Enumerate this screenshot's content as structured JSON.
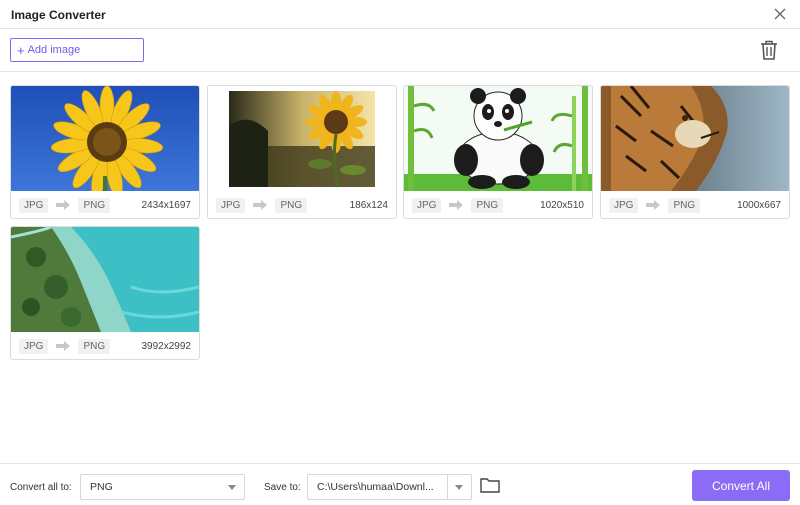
{
  "window": {
    "title": "Image Converter"
  },
  "toolbar": {
    "add_image_label": "Add image"
  },
  "images": [
    {
      "source_format": "JPG",
      "target_format": "PNG",
      "dimensions": "2434x1697"
    },
    {
      "source_format": "JPG",
      "target_format": "PNG",
      "dimensions": "186x124"
    },
    {
      "source_format": "JPG",
      "target_format": "PNG",
      "dimensions": "1020x510"
    },
    {
      "source_format": "JPG",
      "target_format": "PNG",
      "dimensions": "1000x667"
    },
    {
      "source_format": "JPG",
      "target_format": "PNG",
      "dimensions": "3992x2992"
    }
  ],
  "bottom": {
    "convert_all_label": "Convert all to:",
    "convert_all_value": "PNG",
    "save_to_label": "Save to:",
    "save_to_value": "C:\\Users\\humaa\\Downl...",
    "convert_button": "Convert All"
  },
  "colors": {
    "accent": "#8b6cf7",
    "accent_border": "#7b6cf6"
  }
}
